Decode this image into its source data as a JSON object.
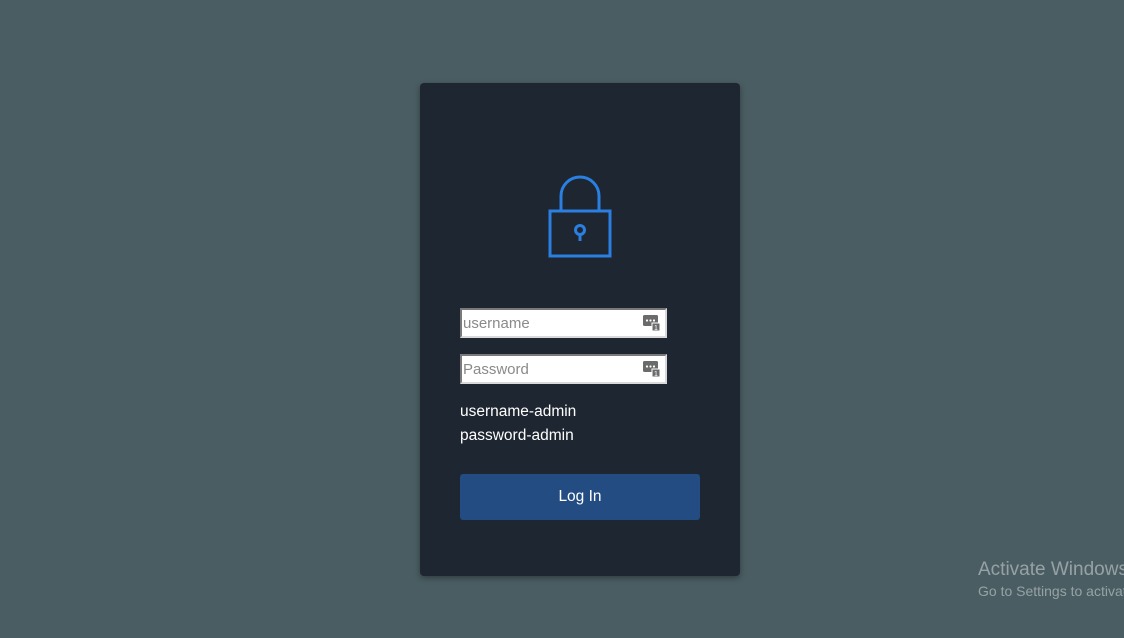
{
  "login": {
    "username_placeholder": "username",
    "password_placeholder": "Password",
    "hint_username": "username-admin",
    "hint_password": "password-admin",
    "button_label": "Log In"
  },
  "icons": {
    "lock": "lock-icon",
    "password_manager": "password-manager-icon"
  },
  "watermark": {
    "line1": "Activate Windows",
    "line2": "Go to Settings to activate Windows."
  },
  "colors": {
    "background": "#4a5d62",
    "card": "#1e2631",
    "accent": "#2a7fe0",
    "button": "#234c83"
  }
}
